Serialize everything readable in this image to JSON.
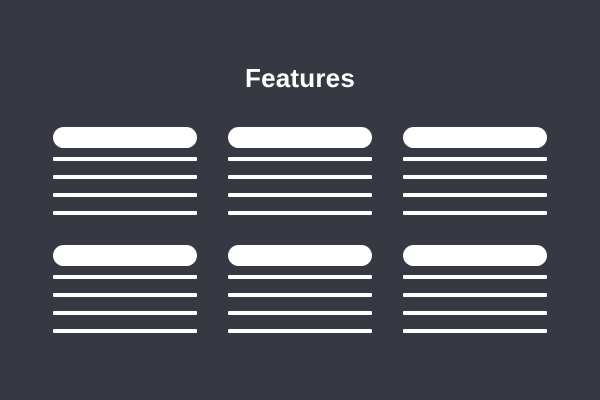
{
  "theme": {
    "background": "#373942",
    "foreground": "#ffffff"
  },
  "section": {
    "title": "Features"
  },
  "features": [
    {
      "placeholder_lines": 4
    },
    {
      "placeholder_lines": 4
    },
    {
      "placeholder_lines": 4
    },
    {
      "placeholder_lines": 4
    },
    {
      "placeholder_lines": 4
    },
    {
      "placeholder_lines": 4
    }
  ]
}
